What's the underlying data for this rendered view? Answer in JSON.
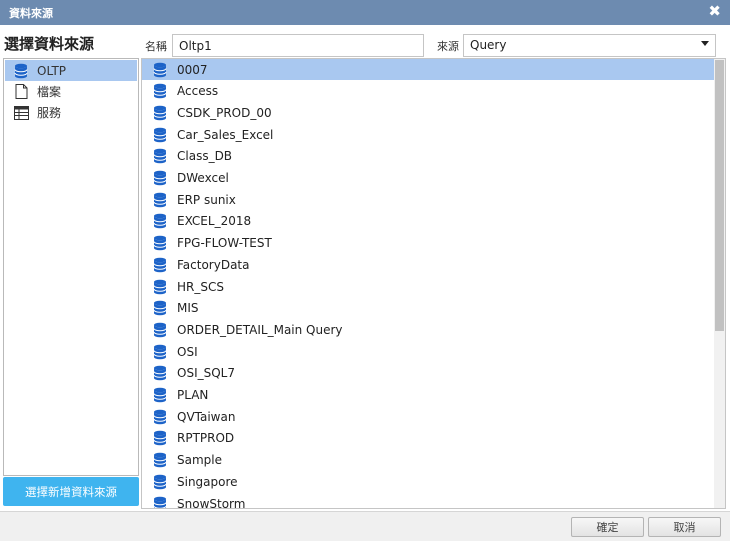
{
  "window": {
    "title": "資料來源",
    "close_glyph": "✖"
  },
  "left": {
    "heading": "選擇資料來源",
    "items": [
      {
        "label": "OLTP",
        "icon": "database-icon"
      },
      {
        "label": "檔案",
        "icon": "file-icon"
      },
      {
        "label": "服務",
        "icon": "service-icon"
      }
    ],
    "selected": "OLTP",
    "add_button": "選擇新增資料來源"
  },
  "form": {
    "name_label": "名稱",
    "name_value": "Oltp1",
    "source_label": "來源",
    "source_value": "Query"
  },
  "list": {
    "selected": "0007",
    "items": [
      "0007",
      "Access",
      "CSDK_PROD_00",
      "Car_Sales_Excel",
      "Class_DB",
      "DWexcel",
      "ERP sunix",
      "EXCEL_2018",
      "FPG-FLOW-TEST",
      "FactoryData",
      "HR_SCS",
      "MIS",
      "ORDER_DETAIL_Main Query",
      "OSI",
      "OSI_SQL7",
      "PLAN",
      "QVTaiwan",
      "RPTPROD",
      "Sample",
      "Singapore",
      "SnowStorm"
    ]
  },
  "footer": {
    "ok": "確定",
    "cancel": "取消"
  },
  "colors": {
    "titlebar": "#6d8bb0",
    "selection": "#a9c8f0",
    "accent_button": "#3fb4ef",
    "db_icon": "#1d63c8"
  }
}
